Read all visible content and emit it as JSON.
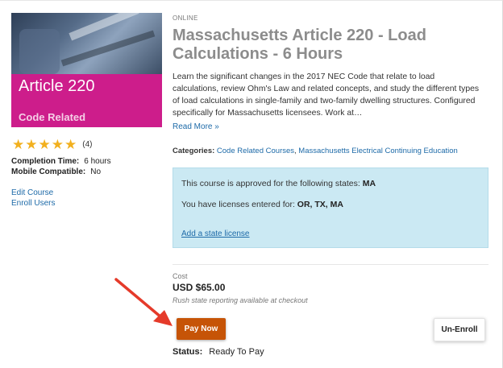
{
  "thumbnail": {
    "title": "Article 220",
    "subtitle": "Code Related"
  },
  "rating": {
    "stars": 5,
    "count": "(4)"
  },
  "meta": {
    "completion_label": "Completion Time:",
    "completion_value": "6 hours",
    "mobile_label": "Mobile Compatible:",
    "mobile_value": "No"
  },
  "left_links": {
    "edit": "Edit Course",
    "enroll": "Enroll Users"
  },
  "badge": "ONLINE",
  "course_title": "Massachusetts Article 220 - Load Calculations - 6 Hours",
  "description": "Learn the significant changes in the 2017 NEC Code that relate to load calculations, review Ohm's Law and related concepts, and study the different types of load calculations in single-family and two-family dwelling structures. Configured specifically for Massachusetts licensees. Work at…",
  "read_more": "Read More »",
  "categories": {
    "label": "Categories:",
    "items": [
      "Code Related Courses",
      "Massachusetts Electrical Continuing Education"
    ]
  },
  "states_box": {
    "approved_text": "This course is approved for the following states:",
    "approved_states": "MA",
    "licenses_text": "You have licenses entered for:",
    "license_states": "OR, TX, MA",
    "add_link": "Add a state license"
  },
  "cost": {
    "label": "Cost",
    "value": "USD $65.00",
    "note": "Rush state reporting available at checkout"
  },
  "buttons": {
    "pay_now": "Pay Now",
    "unenroll": "Un-Enroll"
  },
  "status": {
    "label": "Status:",
    "value": "Ready To Pay"
  },
  "colors": {
    "accent_magenta": "#cd1d8b",
    "pay_button": "#c65407",
    "link": "#1d6aa8",
    "info_box": "#cbe9f3",
    "star": "#f2b01e",
    "arrow": "#e53a2a"
  }
}
